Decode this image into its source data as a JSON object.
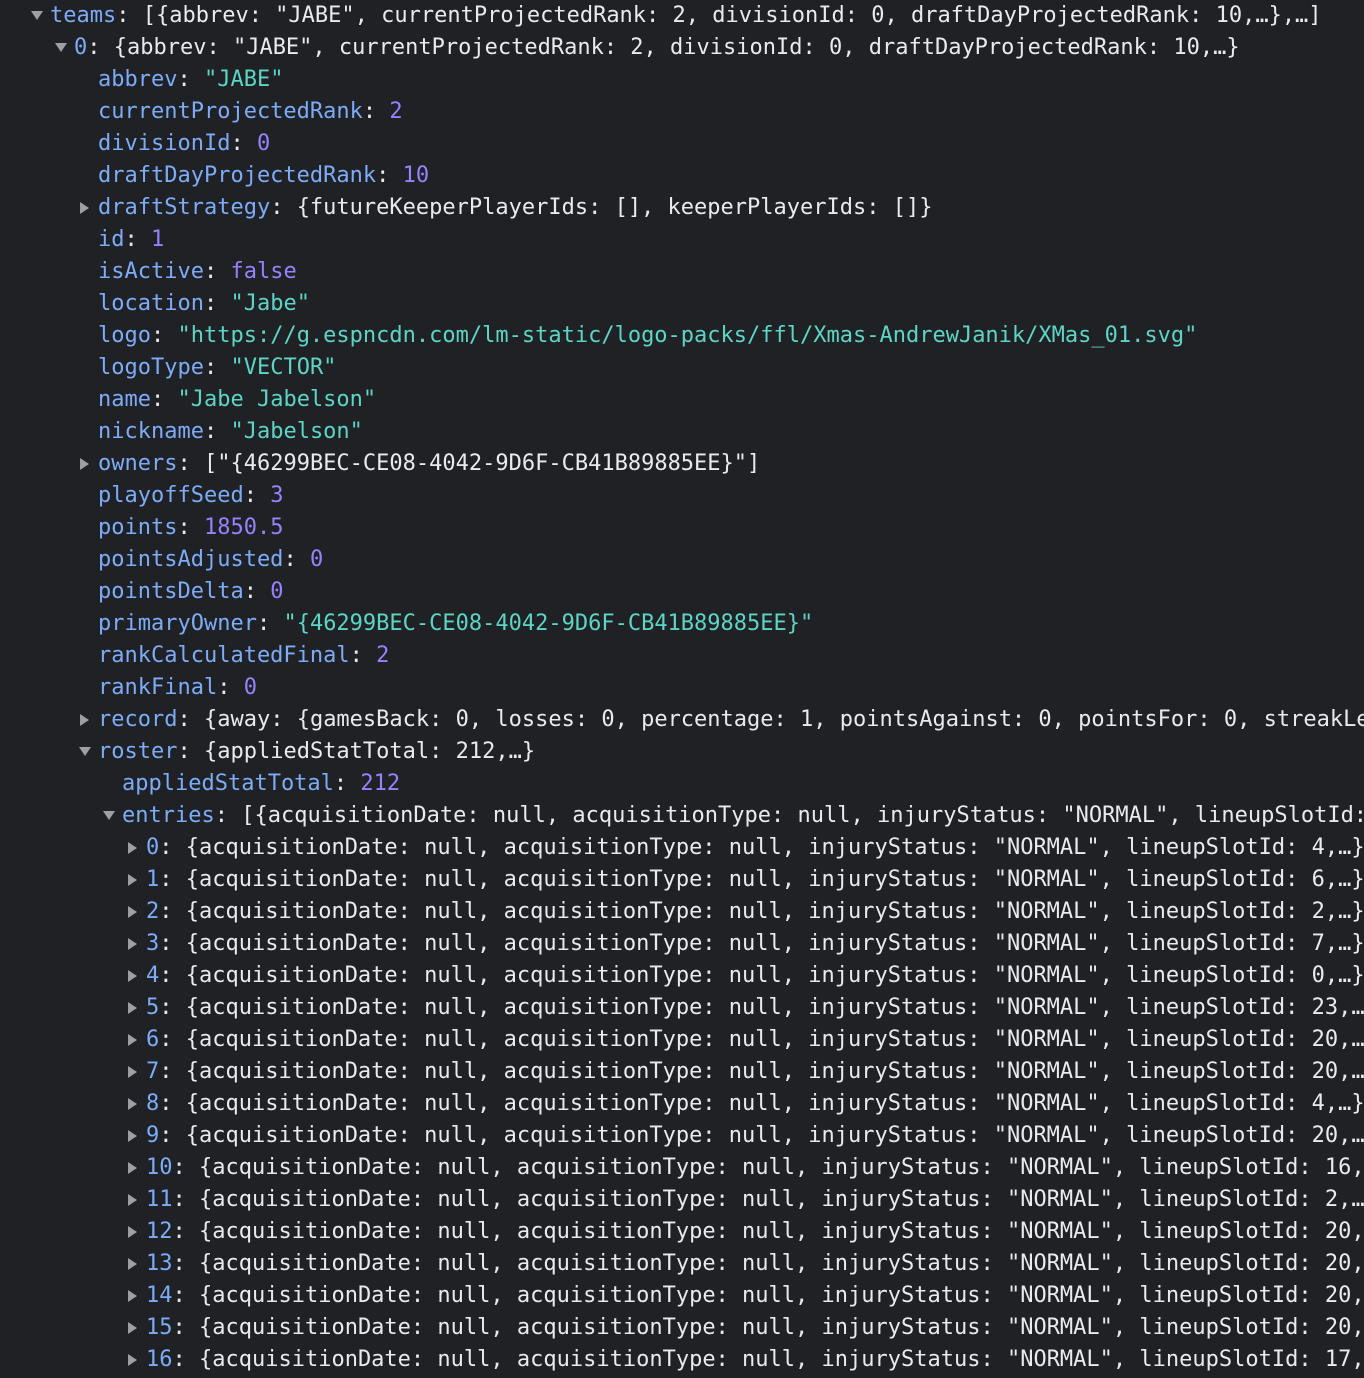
{
  "colors": {
    "background": "#202124",
    "key": "#7cacf8",
    "punctuation": "#e8eaed",
    "string": "#5cd5c6",
    "number": "#9980ff",
    "triangle": "#9aa0a6"
  },
  "rows": [
    {
      "level": 0,
      "toggle": "expanded",
      "key": "teams",
      "preview": "[{abbrev: \"JABE\", currentProjectedRank: 2, divisionId: 0, draftDayProjectedRank: 10,…},…]"
    },
    {
      "level": 1,
      "toggle": "expanded",
      "key": "0",
      "preview": "{abbrev: \"JABE\", currentProjectedRank: 2, divisionId: 0, draftDayProjectedRank: 10,…}"
    },
    {
      "level": 2,
      "toggle": "none",
      "key": "abbrev",
      "value": "\"JABE\"",
      "type": "string"
    },
    {
      "level": 2,
      "toggle": "none",
      "key": "currentProjectedRank",
      "value": "2",
      "type": "number"
    },
    {
      "level": 2,
      "toggle": "none",
      "key": "divisionId",
      "value": "0",
      "type": "number"
    },
    {
      "level": 2,
      "toggle": "none",
      "key": "draftDayProjectedRank",
      "value": "10",
      "type": "number"
    },
    {
      "level": 2,
      "toggle": "collapsed",
      "key": "draftStrategy",
      "preview": "{futureKeeperPlayerIds: [], keeperPlayerIds: []}"
    },
    {
      "level": 2,
      "toggle": "none",
      "key": "id",
      "value": "1",
      "type": "number"
    },
    {
      "level": 2,
      "toggle": "none",
      "key": "isActive",
      "value": "false",
      "type": "boolean"
    },
    {
      "level": 2,
      "toggle": "none",
      "key": "location",
      "value": "\"Jabe\"",
      "type": "string"
    },
    {
      "level": 2,
      "toggle": "none",
      "key": "logo",
      "value": "\"https://g.espncdn.com/lm-static/logo-packs/ffl/Xmas-AndrewJanik/XMas_01.svg\"",
      "type": "string"
    },
    {
      "level": 2,
      "toggle": "none",
      "key": "logoType",
      "value": "\"VECTOR\"",
      "type": "string"
    },
    {
      "level": 2,
      "toggle": "none",
      "key": "name",
      "value": "\"Jabe Jabelson\"",
      "type": "string"
    },
    {
      "level": 2,
      "toggle": "none",
      "key": "nickname",
      "value": "\"Jabelson\"",
      "type": "string"
    },
    {
      "level": 2,
      "toggle": "collapsed",
      "key": "owners",
      "preview": "[\"{46299BEC-CE08-4042-9D6F-CB41B89885EE}\"]"
    },
    {
      "level": 2,
      "toggle": "none",
      "key": "playoffSeed",
      "value": "3",
      "type": "number"
    },
    {
      "level": 2,
      "toggle": "none",
      "key": "points",
      "value": "1850.5",
      "type": "number"
    },
    {
      "level": 2,
      "toggle": "none",
      "key": "pointsAdjusted",
      "value": "0",
      "type": "number"
    },
    {
      "level": 2,
      "toggle": "none",
      "key": "pointsDelta",
      "value": "0",
      "type": "number"
    },
    {
      "level": 2,
      "toggle": "none",
      "key": "primaryOwner",
      "value": "\"{46299BEC-CE08-4042-9D6F-CB41B89885EE}\"",
      "type": "string"
    },
    {
      "level": 2,
      "toggle": "none",
      "key": "rankCalculatedFinal",
      "value": "2",
      "type": "number"
    },
    {
      "level": 2,
      "toggle": "none",
      "key": "rankFinal",
      "value": "0",
      "type": "number"
    },
    {
      "level": 2,
      "toggle": "collapsed",
      "key": "record",
      "preview": "{away: {gamesBack: 0, losses: 0, percentage: 1, pointsAgainst: 0, pointsFor: 0, streakLe"
    },
    {
      "level": 2,
      "toggle": "expanded",
      "key": "roster",
      "preview": "{appliedStatTotal: 212,…}"
    },
    {
      "level": 3,
      "toggle": "none",
      "key": "appliedStatTotal",
      "value": "212",
      "type": "number"
    },
    {
      "level": 3,
      "toggle": "expanded",
      "key": "entries",
      "preview": "[{acquisitionDate: null, acquisitionType: null, injuryStatus: \"NORMAL\", lineupSlotId:"
    },
    {
      "level": 4,
      "toggle": "collapsed",
      "key": "0",
      "preview": "{acquisitionDate: null, acquisitionType: null, injuryStatus: \"NORMAL\", lineupSlotId: 4,…}"
    },
    {
      "level": 4,
      "toggle": "collapsed",
      "key": "1",
      "preview": "{acquisitionDate: null, acquisitionType: null, injuryStatus: \"NORMAL\", lineupSlotId: 6,…}"
    },
    {
      "level": 4,
      "toggle": "collapsed",
      "key": "2",
      "preview": "{acquisitionDate: null, acquisitionType: null, injuryStatus: \"NORMAL\", lineupSlotId: 2,…}"
    },
    {
      "level": 4,
      "toggle": "collapsed",
      "key": "3",
      "preview": "{acquisitionDate: null, acquisitionType: null, injuryStatus: \"NORMAL\", lineupSlotId: 7,…}"
    },
    {
      "level": 4,
      "toggle": "collapsed",
      "key": "4",
      "preview": "{acquisitionDate: null, acquisitionType: null, injuryStatus: \"NORMAL\", lineupSlotId: 0,…}"
    },
    {
      "level": 4,
      "toggle": "collapsed",
      "key": "5",
      "preview": "{acquisitionDate: null, acquisitionType: null, injuryStatus: \"NORMAL\", lineupSlotId: 23,…"
    },
    {
      "level": 4,
      "toggle": "collapsed",
      "key": "6",
      "preview": "{acquisitionDate: null, acquisitionType: null, injuryStatus: \"NORMAL\", lineupSlotId: 20,…"
    },
    {
      "level": 4,
      "toggle": "collapsed",
      "key": "7",
      "preview": "{acquisitionDate: null, acquisitionType: null, injuryStatus: \"NORMAL\", lineupSlotId: 20,…"
    },
    {
      "level": 4,
      "toggle": "collapsed",
      "key": "8",
      "preview": "{acquisitionDate: null, acquisitionType: null, injuryStatus: \"NORMAL\", lineupSlotId: 4,…}"
    },
    {
      "level": 4,
      "toggle": "collapsed",
      "key": "9",
      "preview": "{acquisitionDate: null, acquisitionType: null, injuryStatus: \"NORMAL\", lineupSlotId: 20,…"
    },
    {
      "level": 4,
      "toggle": "collapsed",
      "key": "10",
      "preview": "{acquisitionDate: null, acquisitionType: null, injuryStatus: \"NORMAL\", lineupSlotId: 16,"
    },
    {
      "level": 4,
      "toggle": "collapsed",
      "key": "11",
      "preview": "{acquisitionDate: null, acquisitionType: null, injuryStatus: \"NORMAL\", lineupSlotId: 2,…"
    },
    {
      "level": 4,
      "toggle": "collapsed",
      "key": "12",
      "preview": "{acquisitionDate: null, acquisitionType: null, injuryStatus: \"NORMAL\", lineupSlotId: 20,"
    },
    {
      "level": 4,
      "toggle": "collapsed",
      "key": "13",
      "preview": "{acquisitionDate: null, acquisitionType: null, injuryStatus: \"NORMAL\", lineupSlotId: 20,"
    },
    {
      "level": 4,
      "toggle": "collapsed",
      "key": "14",
      "preview": "{acquisitionDate: null, acquisitionType: null, injuryStatus: \"NORMAL\", lineupSlotId: 20,"
    },
    {
      "level": 4,
      "toggle": "collapsed",
      "key": "15",
      "preview": "{acquisitionDate: null, acquisitionType: null, injuryStatus: \"NORMAL\", lineupSlotId: 20,"
    },
    {
      "level": 4,
      "toggle": "collapsed",
      "key": "16",
      "preview": "{acquisitionDate: null, acquisitionType: null, injuryStatus: \"NORMAL\", lineupSlotId: 17,"
    }
  ]
}
